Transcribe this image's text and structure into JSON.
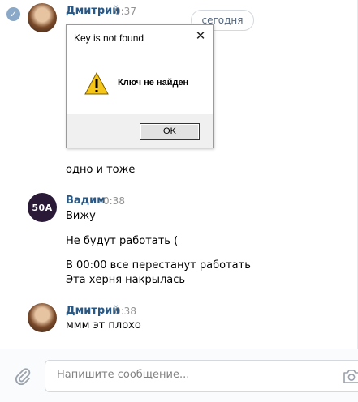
{
  "date_divider": "сегодня",
  "messages": [
    {
      "author": "Дмитрий",
      "time": "0:37",
      "avatar": "avatar-dmitry",
      "lines": [
        "одно и тоже"
      ]
    },
    {
      "author": "Вадим",
      "time": "0:38",
      "avatar": "avatar-vadim",
      "avatar_text": "50A",
      "lines": [
        "Вижу",
        "Не будут работать (",
        "В 00:00 все перестанут работать",
        "Эта херня накрылась"
      ]
    },
    {
      "author": "Дмитрий",
      "time": "0:38",
      "avatar": "avatar-dmitry",
      "lines": [
        "ммм эт плохо"
      ]
    }
  ],
  "dialog": {
    "title": "Key is not found",
    "message": "Ключ не найден",
    "ok_label": "OK",
    "icon": "warning-icon"
  },
  "composer": {
    "placeholder": "Напишите сообщение...",
    "attach_icon": "paperclip-icon",
    "camera_icon": "camera-icon"
  },
  "colors": {
    "author": "#2a5885",
    "time": "#939393",
    "border": "#d3d9de"
  }
}
